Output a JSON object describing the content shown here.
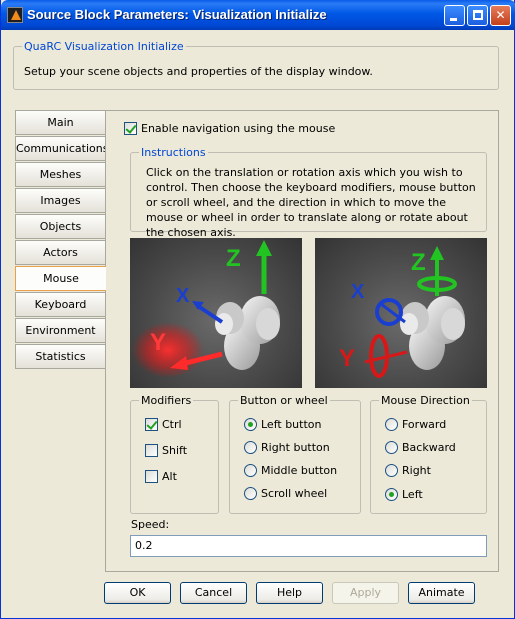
{
  "window": {
    "title": "Source Block Parameters: Visualization Initialize"
  },
  "header": {
    "group_title": "QuaRC Visualization Initialize",
    "description": "Setup your scene objects and properties of the display window."
  },
  "tabs": [
    {
      "label": "Main"
    },
    {
      "label": "Communications"
    },
    {
      "label": "Meshes"
    },
    {
      "label": "Images"
    },
    {
      "label": "Objects"
    },
    {
      "label": "Actors"
    },
    {
      "label": "Mouse"
    },
    {
      "label": "Keyboard"
    },
    {
      "label": "Environment"
    },
    {
      "label": "Statistics"
    }
  ],
  "active_tab": "Mouse",
  "mouse": {
    "enable_navigation": {
      "label": "Enable navigation using the mouse",
      "checked": true
    },
    "instructions": {
      "title": "Instructions",
      "text": "Click on the translation or rotation axis which you wish to control. Then choose the keyboard modifiers, mouse button or scroll wheel, and the direction in which to move the mouse or wheel in order to translate along or rotate about the chosen axis."
    },
    "images": {
      "translate": {
        "axis_z": "Z",
        "axis_x": "X",
        "axis_y": "Y"
      },
      "rotate": {
        "axis_z": "Z",
        "axis_x": "X",
        "axis_y": "Y"
      }
    },
    "modifiers": {
      "title": "Modifiers",
      "items": [
        {
          "label": "Ctrl",
          "checked": true
        },
        {
          "label": "Shift",
          "checked": false
        },
        {
          "label": "Alt",
          "checked": false
        }
      ]
    },
    "button_or_wheel": {
      "title": "Button or wheel",
      "items": [
        {
          "label": "Left button",
          "selected": true
        },
        {
          "label": "Right  button",
          "selected": false
        },
        {
          "label": "Middle  button",
          "selected": false
        },
        {
          "label": "Scroll wheel",
          "selected": false
        }
      ]
    },
    "mouse_direction": {
      "title": "Mouse Direction",
      "items": [
        {
          "label": "Forward",
          "selected": false
        },
        {
          "label": "Backward",
          "selected": false
        },
        {
          "label": "Right",
          "selected": false
        },
        {
          "label": "Left",
          "selected": true
        }
      ]
    },
    "speed": {
      "label": "Speed:",
      "value": "0.2"
    }
  },
  "buttons": {
    "ok": "OK",
    "cancel": "Cancel",
    "help": "Help",
    "apply": "Apply",
    "animate": "Animate"
  },
  "colors": {
    "titlebar": "#0058e6",
    "group_title": "#0046d5",
    "axis_green": "#22c422",
    "axis_blue": "#1a3fd0",
    "axis_red": "#e01818"
  }
}
